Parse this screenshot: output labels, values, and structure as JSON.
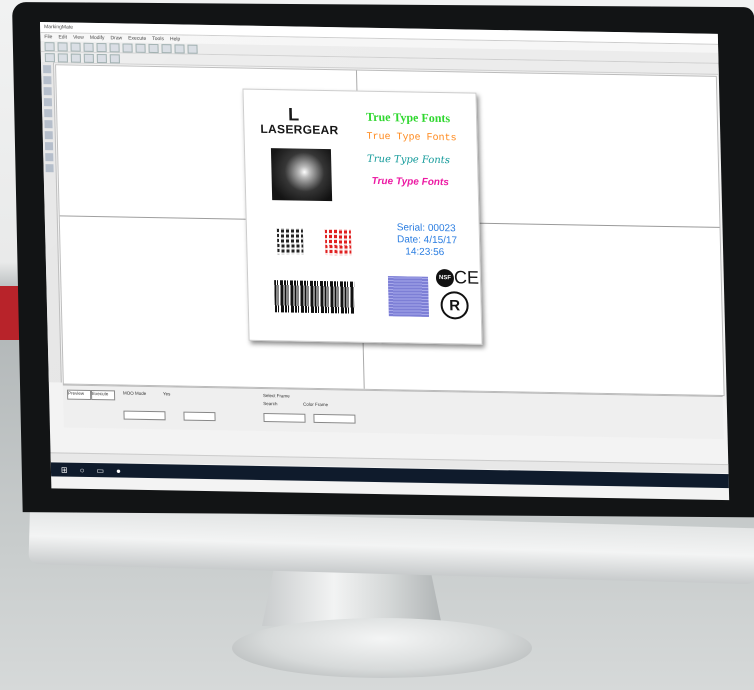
{
  "window": {
    "title": "MarkingMate",
    "menu": [
      "File",
      "Edit",
      "View",
      "Modify",
      "Draw",
      "Execute",
      "Tools",
      "Help"
    ]
  },
  "label": {
    "logo_mark": "L",
    "logo_text": "LASERGEAR",
    "fonts": [
      {
        "text": "True Type Fonts",
        "color": "#2ed72e",
        "style": "serif-bold"
      },
      {
        "text": "True Type Fonts",
        "color": "#ff8a1e",
        "style": "mono"
      },
      {
        "text": "True Type Fonts",
        "color": "#139a9a",
        "style": "script"
      },
      {
        "text": "True Type Fonts",
        "color": "#ec1aa3",
        "style": "italic-bold"
      }
    ],
    "serial": "Serial: 00023",
    "date": "Date: 4/15/17",
    "time": "14:23:56",
    "nsf": "NSF",
    "ce": "CE",
    "registered": "R"
  },
  "bottom_panel": {
    "preview_label": "Preview",
    "execute_label": "Execute",
    "items": [
      "MOO Mode",
      "Yes",
      "Select Frame",
      "Search",
      "Color Frame"
    ]
  },
  "colors": {
    "band": "#b8232a",
    "serial": "#2a7de1"
  }
}
